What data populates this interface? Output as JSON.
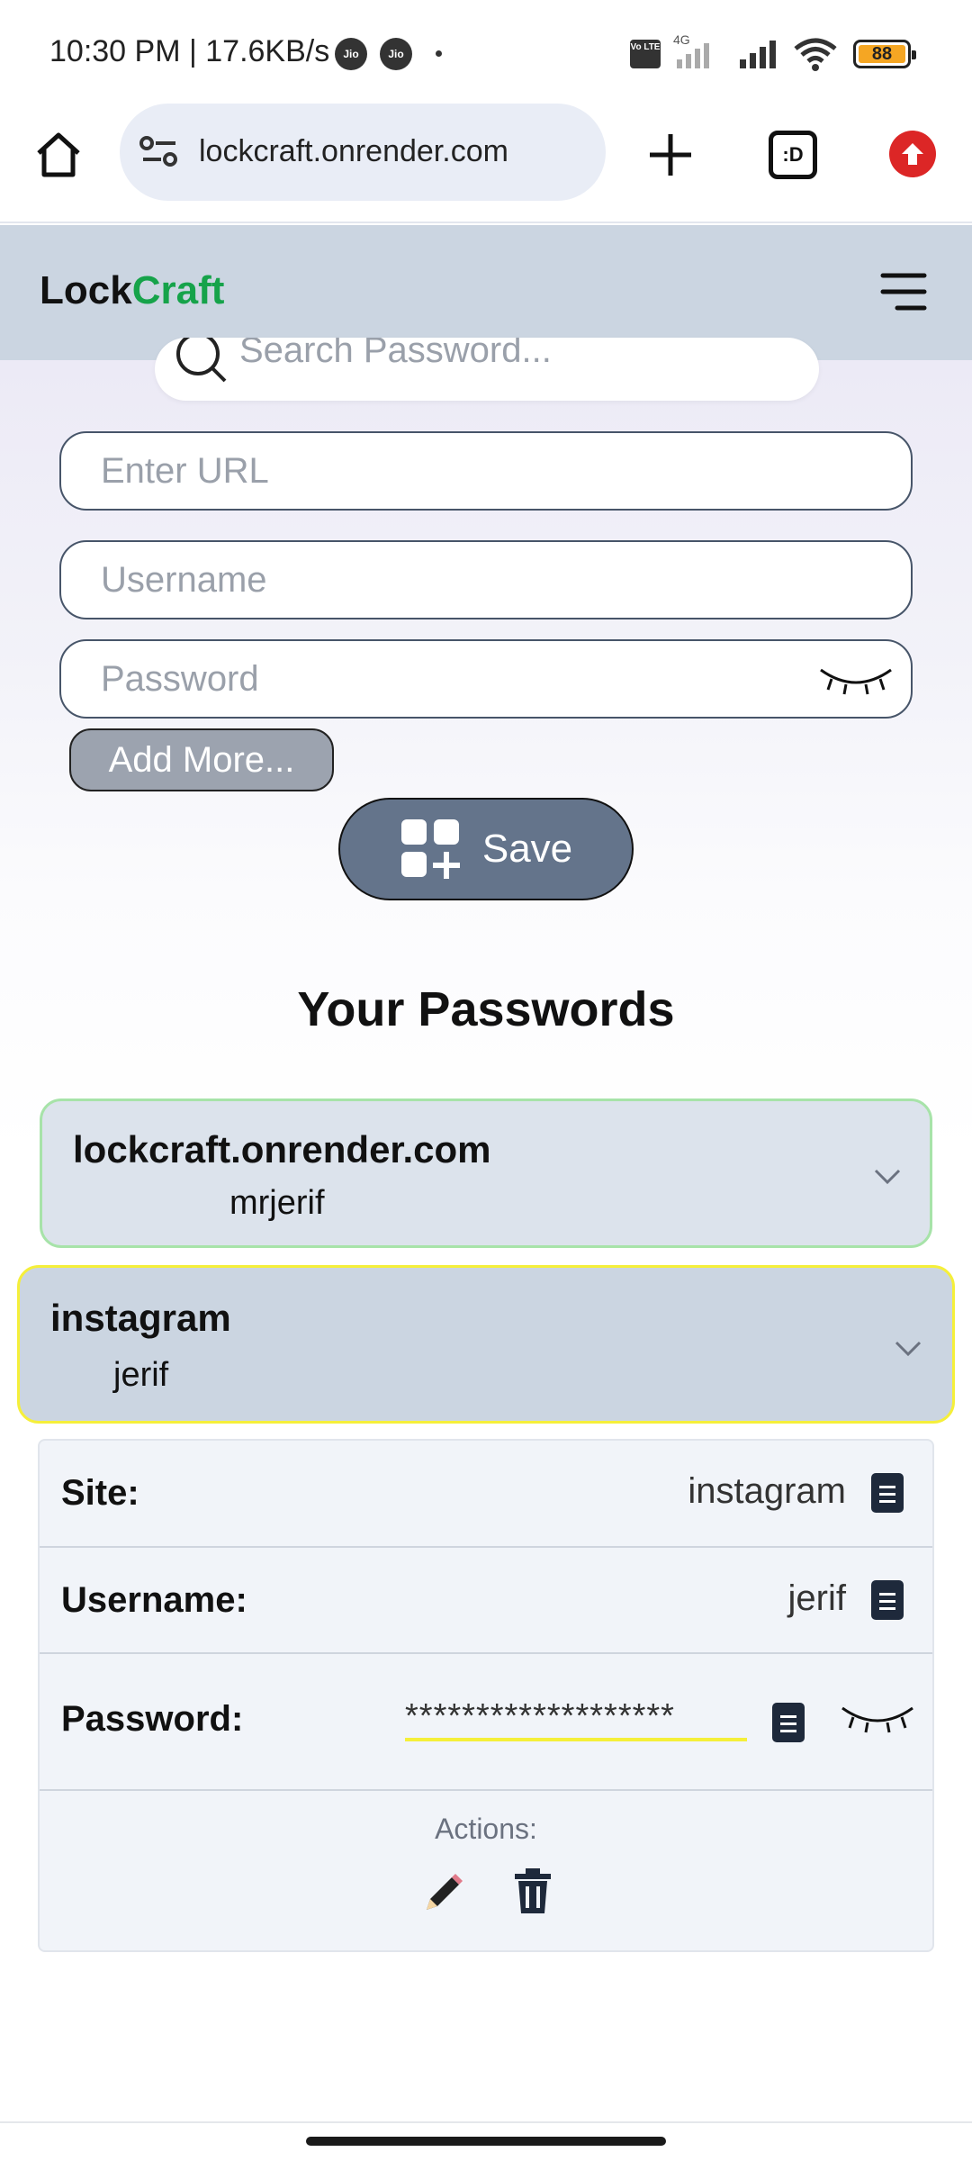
{
  "status_bar": {
    "time_speed": "10:30 PM | 17.6KB/s",
    "carrier1": "Jio",
    "carrier2": "Jio",
    "network": "4G",
    "volte": "Vo LTE",
    "battery": "88"
  },
  "browser": {
    "url": "lockcraft.onrender.com",
    "tab_switcher": ":D"
  },
  "header": {
    "brand_part1": "Lock",
    "brand_part2": "Craft"
  },
  "form": {
    "search_placeholder": "Search Password...",
    "url_placeholder": "Enter URL",
    "username_placeholder": "Username",
    "password_placeholder": "Password",
    "add_more_label": "Add More...",
    "save_label": "Save"
  },
  "section_title": "Your Passwords",
  "passwords": [
    {
      "site": "lockcraft.onrender.com",
      "username": "mrjerif"
    },
    {
      "site": "instagram",
      "username": "jerif"
    }
  ],
  "details": {
    "site_label": "Site:",
    "site_value": "instagram",
    "username_label": "Username:",
    "username_value": "jerif",
    "password_label": "Password:",
    "password_value": "*******************",
    "actions_label": "Actions:"
  },
  "colors": {
    "header_bg": "#cbd5e1",
    "brand_accent": "#16a34a",
    "save_bg": "#64748b",
    "card1_border": "#a7e3a9",
    "card2_border": "#f5ef3a",
    "password_underline": "#f5ef3a"
  }
}
